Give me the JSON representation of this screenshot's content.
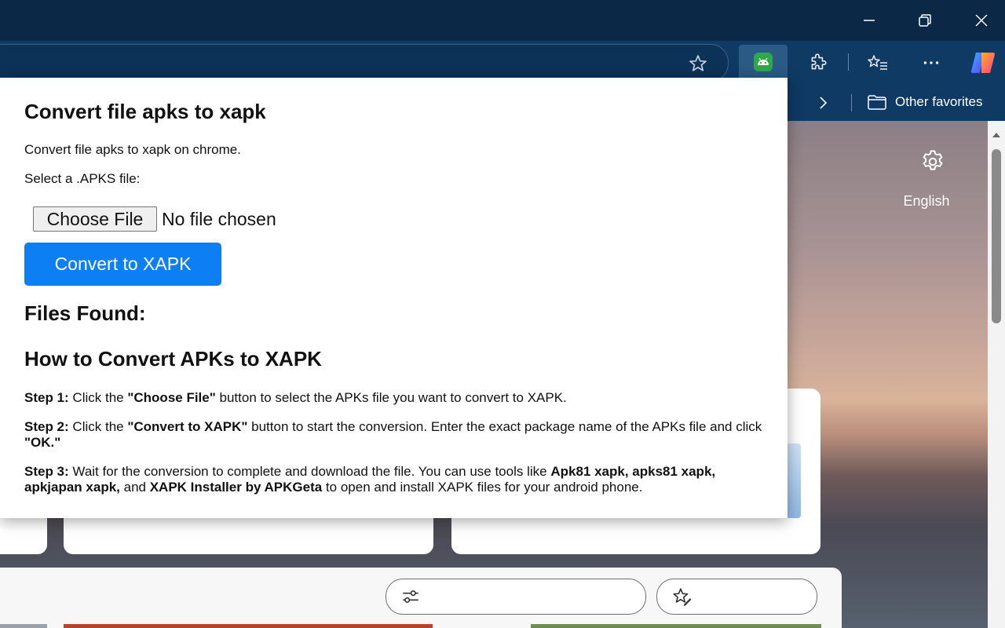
{
  "window": {
    "minimize_icon": "minimize-icon",
    "restore_icon": "restore-icon",
    "close_icon": "close-icon"
  },
  "toolbar": {
    "favorite_icon": "star-icon",
    "active_extension_icon": "android-icon",
    "extensions_icon": "puzzle-icon",
    "favorites_icon": "star-list-icon",
    "more_icon": "more-horizontal-icon",
    "copilot_icon": "copilot-icon"
  },
  "favorites_bar": {
    "chevron_icon": "chevron-right-icon",
    "other_favorites": "Other favorites"
  },
  "newtab": {
    "settings_icon": "gear-icon",
    "language": "English",
    "filter_icon": "sliders-icon",
    "personalize_icon": "star-edit-icon"
  },
  "popup": {
    "title": "Convert file apks to xapk",
    "description": "Convert file apks to xapk on chrome.",
    "select_label": "Select a .APKS file:",
    "choose_file": "Choose File",
    "no_file": "No file chosen",
    "convert_button": "Convert to XAPK",
    "files_found": "Files Found:",
    "how_title": "How to Convert APKs to XAPK",
    "steps": [
      {
        "label": "Step 1:",
        "t1": " Click the ",
        "b1": "\"Choose File\"",
        "t2": " button to select the APKs file you want to convert to XAPK."
      },
      {
        "label": "Step 2:",
        "t1": " Click the ",
        "b1": "\"Convert to XAPK\"",
        "t2": " button to start the conversion. Enter the exact package name of the APKs file and click ",
        "b2": "\"OK.\""
      },
      {
        "label": "Step 3:",
        "t1": " Wait for the conversion to complete and download the file. You can use tools like ",
        "b1": "Apk81 xapk, apks81 xapk, apkjapan xapk,",
        "t2": " and ",
        "b2": "XAPK Installer by APKGeta",
        "t3": " to open and install XAPK files for your android phone."
      }
    ]
  },
  "colors": {
    "titlebar": "#0b2847",
    "toolbar": "#0e3a64",
    "accent_button": "#0d7ff5"
  }
}
